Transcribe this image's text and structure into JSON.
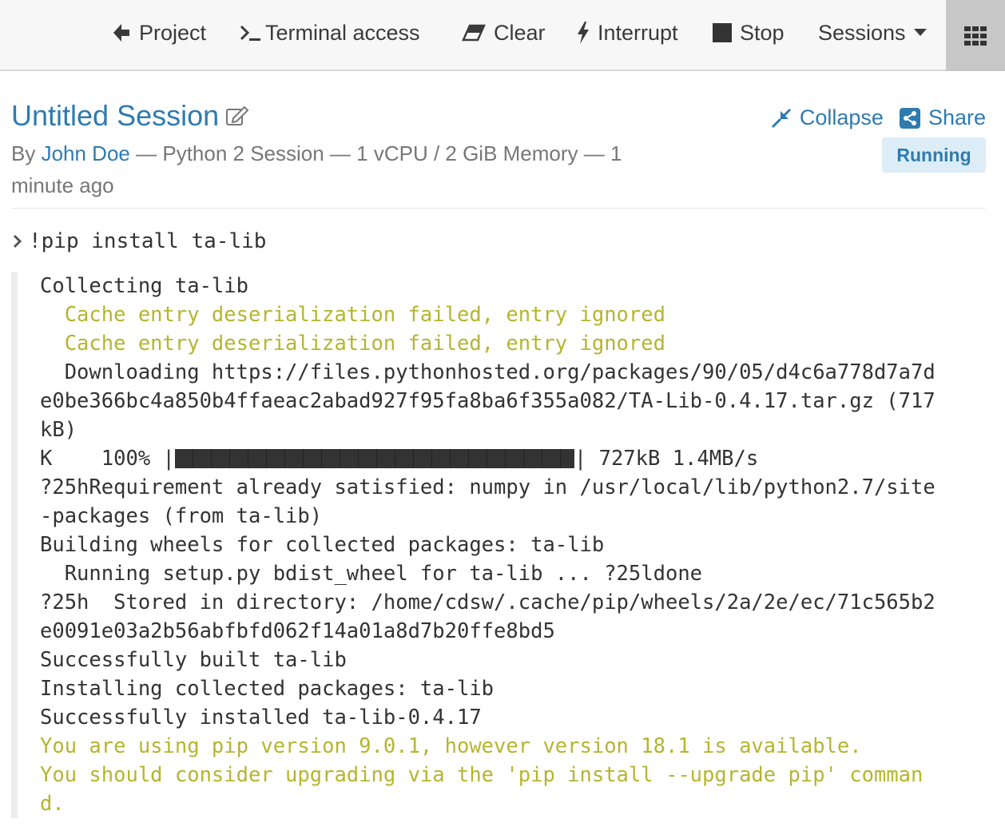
{
  "topbar": {
    "project": "Project",
    "terminal": "Terminal access",
    "clear": "Clear",
    "interrupt": "Interrupt",
    "stop": "Stop",
    "sessions": "Sessions"
  },
  "icons": {
    "project": "arrow-left-icon",
    "terminal": "terminal-prompt-icon",
    "clear": "eraser-icon",
    "interrupt": "bolt-icon",
    "stop": "stop-square-icon",
    "sessions": "caret-down-icon",
    "apps": "grid-icon",
    "edit": "edit-icon",
    "collapse": "compress-icon",
    "share": "share-icon",
    "prompt": "chevron-right-icon"
  },
  "session": {
    "title": "Untitled Session",
    "by_label": "By",
    "author": "John Doe",
    "details": "— Python 2 Session — 1 vCPU / 2 GiB Memory — 1 minute ago",
    "collapse": "Collapse",
    "share": "Share",
    "status": "Running"
  },
  "colors": {
    "link": "#2f7bb0",
    "warning_text": "#b5b530",
    "badge_bg": "#dcedf7",
    "topbar_bg": "#f7f7f7"
  },
  "cell": {
    "input": "!pip install ta-lib",
    "output": [
      {
        "text": "Collecting ta-lib",
        "warn": false
      },
      {
        "text": "  Cache entry deserialization failed, entry ignored",
        "warn": true
      },
      {
        "text": "  Cache entry deserialization failed, entry ignored",
        "warn": true
      },
      {
        "text": "  Downloading https://files.pythonhosted.org/packages/90/05/d4c6a778d7a7d",
        "warn": false
      },
      {
        "text": "e0be366bc4a850b4ffaeac2abad927f95fa8ba6f355a082/TA-Lib-0.4.17.tar.gz (717",
        "warn": false
      },
      {
        "text": "kB)",
        "warn": false
      },
      {
        "progress": true,
        "prefix": "K    100% |",
        "suffix": "| 727kB 1.4MB/s",
        "percent": 100
      },
      {
        "text": "?25hRequirement already satisfied: numpy in /usr/local/lib/python2.7/site",
        "warn": false
      },
      {
        "text": "-packages (from ta-lib)",
        "warn": false
      },
      {
        "text": "Building wheels for collected packages: ta-lib",
        "warn": false
      },
      {
        "text": "  Running setup.py bdist_wheel for ta-lib ... ?25ldone",
        "warn": false
      },
      {
        "text": "?25h  Stored in directory: /home/cdsw/.cache/pip/wheels/2a/2e/ec/71c565b2",
        "warn": false
      },
      {
        "text": "e0091e03a2b56abfbfd062f14a01a8d7b20ffe8bd5",
        "warn": false
      },
      {
        "text": "Successfully built ta-lib",
        "warn": false
      },
      {
        "text": "Installing collected packages: ta-lib",
        "warn": false
      },
      {
        "text": "Successfully installed ta-lib-0.4.17",
        "warn": false
      },
      {
        "text": "You are using pip version 9.0.1, however version 18.1 is available.",
        "warn": true
      },
      {
        "text": "You should consider upgrading via the 'pip install --upgrade pip' comman",
        "warn": true
      },
      {
        "text": "d.",
        "warn": true
      }
    ]
  }
}
